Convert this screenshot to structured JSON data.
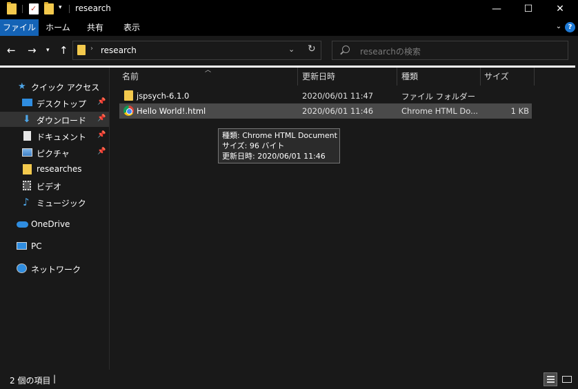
{
  "window": {
    "title": "research",
    "controls": {
      "minimize": "—",
      "maximize": "☐",
      "close": "✕"
    }
  },
  "ribbon": {
    "tabs": [
      {
        "label": "ファイル",
        "active": true
      },
      {
        "label": "ホーム"
      },
      {
        "label": "共有"
      },
      {
        "label": "表示"
      }
    ],
    "accent": "#1463b6"
  },
  "address": {
    "path": "research",
    "search_placeholder": "researchの検索"
  },
  "sidebar": {
    "items": [
      {
        "label": "クイック アクセス",
        "icon": "star-icon"
      },
      {
        "label": "デスクトップ",
        "icon": "desktop-icon",
        "pinned": true
      },
      {
        "label": "ダウンロード",
        "icon": "download-icon",
        "pinned": true,
        "selected": true
      },
      {
        "label": "ドキュメント",
        "icon": "document-icon",
        "pinned": true
      },
      {
        "label": "ピクチャ",
        "icon": "picture-icon",
        "pinned": true
      },
      {
        "label": "researches",
        "icon": "folder-icon"
      },
      {
        "label": "ビデオ",
        "icon": "video-icon"
      },
      {
        "label": "ミュージック",
        "icon": "music-icon"
      },
      {
        "label": "OneDrive",
        "icon": "cloud-icon"
      },
      {
        "label": "PC",
        "icon": "pc-icon"
      },
      {
        "label": "ネットワーク",
        "icon": "network-icon"
      }
    ]
  },
  "files": {
    "columns": [
      "名前",
      "更新日時",
      "種類",
      "サイズ"
    ],
    "rows": [
      {
        "name": "jspsych-6.1.0",
        "modified": "2020/06/01 11:47",
        "type": "ファイル フォルダー",
        "size": "",
        "icon": "folder-icon"
      },
      {
        "name": "Hello World!.html",
        "modified": "2020/06/01 11:46",
        "type": "Chrome HTML Do...",
        "size": "1 KB",
        "icon": "chrome-icon"
      }
    ]
  },
  "tooltip": {
    "type_line": "種類: Chrome HTML Document",
    "size_line": "サイズ: 96 バイト",
    "modified_line": "更新日時: 2020/06/01 11:46"
  },
  "status": {
    "item_count": "2 個の項目",
    "caret": "|"
  }
}
